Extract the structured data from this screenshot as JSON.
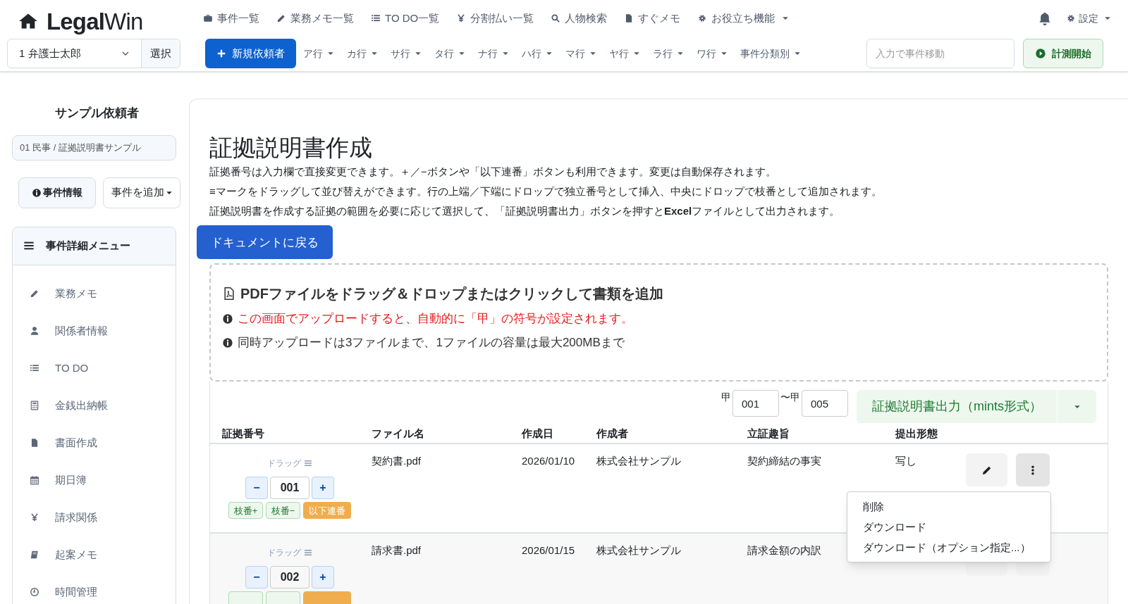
{
  "header": {
    "logo": {
      "bold": "Legal",
      "light": "Win"
    },
    "nav": [
      {
        "label": "事件一覧",
        "dropdown": false
      },
      {
        "label": "業務メモ一覧",
        "dropdown": false
      },
      {
        "label": "TO DO一覧",
        "dropdown": false
      },
      {
        "label": "分割払い一覧",
        "dropdown": false
      },
      {
        "label": "人物検索",
        "dropdown": false
      },
      {
        "label": "すぐメモ",
        "dropdown": false
      },
      {
        "label": "お役立ち機能",
        "dropdown": true
      }
    ],
    "settings": {
      "label": "設定",
      "dropdown": true
    },
    "user_select": {
      "value": "1 弁護士太郎"
    },
    "select_button": "選択",
    "new_client_button": "新規依頼者",
    "kana_tabs": [
      {
        "label": "ア行"
      },
      {
        "label": "カ行"
      },
      {
        "label": "サ行"
      },
      {
        "label": "タ行"
      },
      {
        "label": "ナ行"
      },
      {
        "label": "ハ行"
      },
      {
        "label": "マ行"
      },
      {
        "label": "ヤ行"
      },
      {
        "label": "ラ行"
      },
      {
        "label": "ワ行"
      },
      {
        "label": "事件分類別"
      }
    ],
    "case_jump": {
      "placeholder": "入力で事件移動"
    },
    "timer_button": "計測開始"
  },
  "sidebar": {
    "client": "サンプル依頼者",
    "case": "01 民事 / 証拠説明書サンプル",
    "case_info_button": "事件情報",
    "add_case_button": "事件を追加",
    "menu_title": "事件詳細メニュー",
    "items": [
      {
        "label": "業務メモ"
      },
      {
        "label": "関係者情報"
      },
      {
        "label": "TO DO"
      },
      {
        "label": "金銭出納帳"
      },
      {
        "label": "書面作成"
      },
      {
        "label": "期日簿"
      },
      {
        "label": "請求関係"
      },
      {
        "label": "起案メモ"
      },
      {
        "label": "時間管理"
      }
    ]
  },
  "main": {
    "title": "証拠説明書作成",
    "descriptions": [
      "証拠番号は入力欄で直接変更できます。＋／−ボタンや「以下連番」ボタンも利用できます。変更は自動保存されます。",
      "≡マークをドラッグして並び替えができます。行の上端／下端にドロップで独立番号として挿入、中央にドロップで枝番として追加されます。",
      "証拠説明書を作成する証拠の範囲を必要に応じて選択して、「証拠説明書出力」ボタンを押すと**Excel**ファイルとして出力されます。"
    ],
    "back_button": "ドキュメントに戻る",
    "dropzone": {
      "title": "PDFファイルをドラッグ＆ドロップまたはクリックして書類を追加",
      "notes": [
        {
          "kind": "warning",
          "text": "この画面でアップロードすると、自動的に「甲」の符号が設定されます。"
        },
        {
          "kind": "info",
          "text": "同時アップロードは3ファイルまで、1ファイルの容量は最大200MBまで"
        }
      ]
    },
    "range": {
      "from_prefix": "甲",
      "from": "001",
      "separator": "〜",
      "to_prefix": "甲",
      "to": "005"
    },
    "output_button": "証拠説明書出力（mints形式）",
    "columns": [
      "証拠番号",
      "ファイル名",
      "作成日",
      "作成者",
      "立証趣旨",
      "提出形態"
    ],
    "rows": [
      {
        "drag_label": "ドラッグ",
        "minus": "−",
        "number": "001",
        "plus": "+",
        "branch_buttons": [
          {
            "kind": "branch",
            "label": "枝番+"
          },
          {
            "kind": "branch",
            "label": "枝番−"
          },
          {
            "kind": "sequence",
            "label": "以下連番"
          }
        ],
        "file": "契約書.pdf",
        "date": "2026/01/10",
        "author": "株式会社サンプル",
        "purpose": "契約締結の事実",
        "form": "写し",
        "menu_open": true
      },
      {
        "drag_label": "ドラッグ",
        "minus": "−",
        "number": "002",
        "plus": "+",
        "branch_buttons": [
          {
            "kind": "branch"
          },
          {
            "kind": "branch"
          },
          {
            "kind": "sequence"
          }
        ],
        "file": "請求書.pdf",
        "date": "2026/01/15",
        "author": "株式会社サンプル",
        "purpose": "請求金額の内訳",
        "menu_open": false
      }
    ],
    "row_menu": [
      "削除",
      "ダウンロード",
      "ダウンロード（オプション指定...）"
    ]
  }
}
